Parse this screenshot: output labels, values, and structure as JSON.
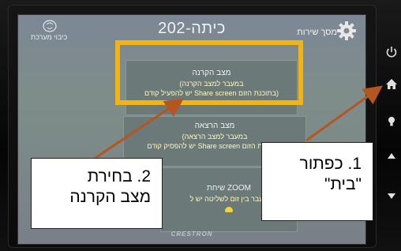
{
  "screen": {
    "title": "כיתה-202",
    "power_off_label": "כיבוי מערכת",
    "settings_label": "מסך שירות",
    "brand": "CRESTRON"
  },
  "modes": [
    {
      "title": "מצב הקרנה",
      "line1": "(במעבר למצב הקרנה",
      "line2": "יש להפעיל קודם Share screen בתוכנת הזום)",
      "highlighted": true
    },
    {
      "title": "מצב הרצאה",
      "line1": "(במעבר למצב הרצאה",
      "line2": "יש להפסיק קודם Share screen בתוכנת הזום)"
    },
    {
      "title": "שיחת ZOOM",
      "line1": "מעבר בין זום לשליטה יש ל"
    }
  ],
  "side_buttons": [
    "power-icon",
    "home-icon",
    "light-bulb-icon",
    "up-arrow-icon",
    "down-arrow-icon"
  ],
  "callouts": {
    "home": {
      "line1": "1. כפתור",
      "line2": "\"בית\""
    },
    "projection": {
      "line1": "2. בחירת",
      "line2": "מצב הקרנה"
    }
  },
  "colors": {
    "highlight": "#f2b315",
    "arrow": "#b5551f",
    "screen_bg": "#7f8d8a"
  }
}
